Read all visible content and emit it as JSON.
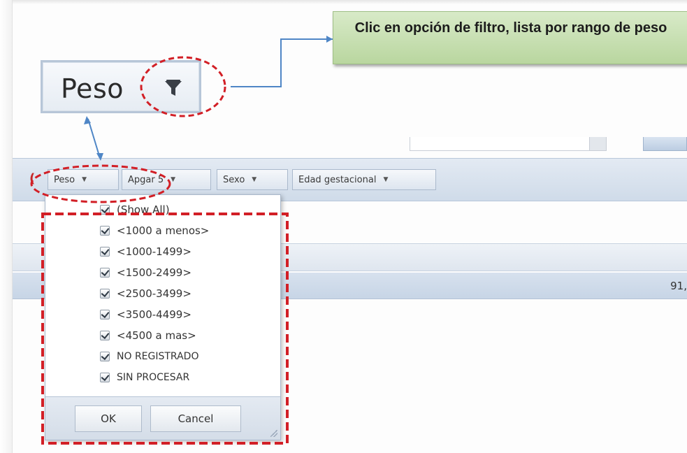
{
  "callout": {
    "text": "Clic en opción de filtro, lista por rango de peso"
  },
  "zoomed_header": {
    "label": "Peso",
    "icon": "filter-icon"
  },
  "filter_toolbar": {
    "buttons": [
      {
        "label": "Peso",
        "icon": "dropdown-arrow-icon"
      },
      {
        "label": "Apgar 5",
        "icon": "dropdown-arrow-icon"
      },
      {
        "label": "Sexo",
        "icon": "dropdown-arrow-icon"
      },
      {
        "label": "Edad gestacional",
        "icon": "dropdown-arrow-icon"
      }
    ]
  },
  "grid": {
    "data_row_value": "91,"
  },
  "dropdown": {
    "options": [
      {
        "label": "(Show All)",
        "checked": true
      },
      {
        "label": "<1000 a menos>",
        "checked": true
      },
      {
        "label": "<1000-1499>",
        "checked": true
      },
      {
        "label": "<1500-2499>",
        "checked": true
      },
      {
        "label": "<2500-3499>",
        "checked": true
      },
      {
        "label": "<3500-4499>",
        "checked": true
      },
      {
        "label": "<4500 a mas>",
        "checked": true
      },
      {
        "label": "NO REGISTRADO",
        "checked": true
      },
      {
        "label": "SIN PROCESAR",
        "checked": true
      }
    ],
    "ok_label": "OK",
    "cancel_label": "Cancel"
  },
  "colors": {
    "callout_bg": "#c6e0b4",
    "annotation_red": "#d21f26",
    "connector_blue": "#4f86c6",
    "toolbar_bg": "#d5e0ec"
  }
}
